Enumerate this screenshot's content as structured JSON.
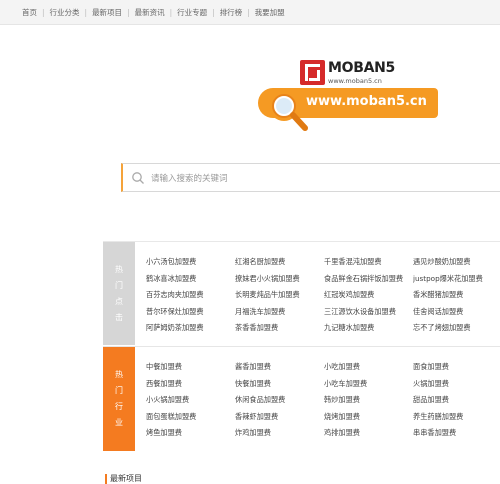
{
  "topnav": [
    "首页",
    "行业分类",
    "最新项目",
    "最新资讯",
    "行业专题",
    "排行榜",
    "我要加盟"
  ],
  "logo": {
    "name": "MOBAN5",
    "url": "www.moban5.cn"
  },
  "banner": {
    "text": "www.moban5.cn"
  },
  "search": {
    "placeholder": "请输入搜索的关键词"
  },
  "hot": {
    "label": [
      "热",
      "门",
      "点",
      "击"
    ],
    "rows": [
      [
        "小六汤包加盟费",
        "红湘名厨加盟费",
        "千里香混沌加盟费",
        "遇见炒酸奶加盟费"
      ],
      [
        "鹤冰喜冰加盟费",
        "撩妹君小火锅加盟费",
        "食品鲜金石锅拌饭加盟费",
        "justpop爆米花加盟费"
      ],
      [
        "百芬志肉夹加盟费",
        "长明麦炖品牛加盟费",
        "红冠炭鸡加盟费",
        "香米醋猪加盟费"
      ],
      [
        "普尔环保灶加盟费",
        "月福洗车加盟费",
        "三江源饮水设备加盟费",
        "佳舍阅话加盟费"
      ],
      [
        "阿萨姆奶茶加盟费",
        "茶香香加盟费",
        "九记糖水加盟费",
        "忘不了烤翅加盟费"
      ]
    ]
  },
  "industry": {
    "label": [
      "热",
      "门",
      "行",
      "业"
    ],
    "rows": [
      [
        "中餐加盟费",
        "酱香加盟费",
        "小吃加盟费",
        "面食加盟费"
      ],
      [
        "西餐加盟费",
        "快餐加盟费",
        "小吃车加盟费",
        "火锅加盟费"
      ],
      [
        "小火锅加盟费",
        "休闲食品加盟费",
        "韩炒加盟费",
        "甜品加盟费"
      ],
      [
        "面包蛋糕加盟费",
        "香辣虾加盟费",
        "烧烤加盟费",
        "养生药膳加盟费"
      ],
      [
        "烤鱼加盟费",
        "炸鸡加盟费",
        "鸡排加盟费",
        "串串香加盟费"
      ]
    ]
  },
  "section_title": "最新项目",
  "colors": {
    "accent": "#f47b20",
    "brand": "#d52a2a"
  }
}
